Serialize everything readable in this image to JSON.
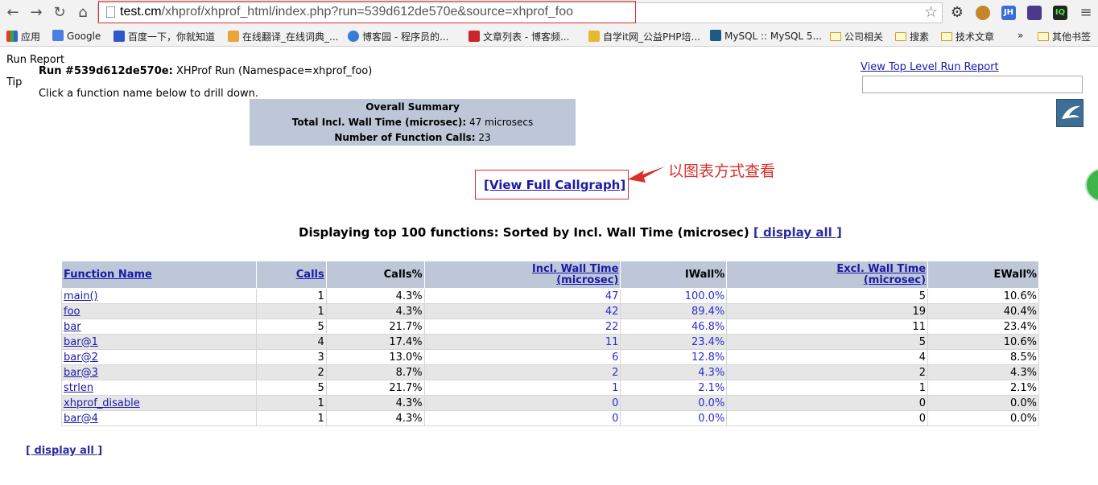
{
  "browser": {
    "url_host": "test.cm",
    "url_path": "/xhprof/xhprof_html/index.php?run=539d612de570e&source=xhprof_foo",
    "extensions": [
      "JH",
      "IQ"
    ],
    "bookmarks": [
      {
        "label": "应用",
        "icon": "apps-grid-icon"
      },
      {
        "label": "Google",
        "icon": "google-icon"
      },
      {
        "label": "百度一下，你就知道",
        "icon": "baidu-paw-icon"
      },
      {
        "label": "在线翻译_在线词典_...",
        "icon": "translate-icon"
      },
      {
        "label": "博客园 - 程序员的...",
        "icon": "cnblogs-icon"
      },
      {
        "label": "文章列表 - 博客频...",
        "icon": "csdn-icon"
      },
      {
        "label": "自学it网_公益PHP培...",
        "icon": "zixue-icon"
      },
      {
        "label": "MySQL :: MySQL 5...",
        "icon": "mysql-icon"
      },
      {
        "label": "公司相关",
        "icon": "folder-icon"
      },
      {
        "label": "搜素",
        "icon": "folder-icon"
      },
      {
        "label": "技术文章",
        "icon": "folder-icon"
      },
      {
        "label": "»",
        "icon": "overflow-icon"
      },
      {
        "label": "其他书签",
        "icon": "folder-icon"
      }
    ]
  },
  "page": {
    "run_report_label": "Run Report",
    "run_title": "Run #539d612de570e:",
    "run_desc": "XHProf Run (Namespace=xhprof_foo)",
    "tip_label": "Tip",
    "tip_text": "Click a function name below to drill down.",
    "top_level_link": "View Top Level Run Report",
    "summary": {
      "title": "Overall Summary",
      "wall_label": "Total Incl. Wall Time (microsec):",
      "wall_value": "47 microsecs",
      "calls_label": "Number of Function Calls:",
      "calls_value": "23"
    },
    "callgraph_link": "[View Full Callgraph]",
    "annotation": "以图表方式查看",
    "displaying_text": "Displaying top 100 functions: Sorted by Incl. Wall Time (microsec)",
    "display_all": "[ display all ]"
  },
  "table": {
    "headers": [
      "Function Name",
      "Calls",
      "Calls%",
      "Incl. Wall Time",
      "(microsec)",
      "IWall%",
      "Excl. Wall Time",
      "(microsec)",
      "EWall%"
    ],
    "rows": [
      [
        "main()",
        "1",
        "4.3%",
        "47",
        "100.0%",
        "5",
        "10.6%"
      ],
      [
        "foo",
        "1",
        "4.3%",
        "42",
        "89.4%",
        "19",
        "40.4%"
      ],
      [
        "bar",
        "5",
        "21.7%",
        "22",
        "46.8%",
        "11",
        "23.4%"
      ],
      [
        "bar@1",
        "4",
        "17.4%",
        "11",
        "23.4%",
        "5",
        "10.6%"
      ],
      [
        "bar@2",
        "3",
        "13.0%",
        "6",
        "12.8%",
        "4",
        "8.5%"
      ],
      [
        "bar@3",
        "2",
        "8.7%",
        "2",
        "4.3%",
        "2",
        "4.3%"
      ],
      [
        "strlen",
        "5",
        "21.7%",
        "1",
        "2.1%",
        "1",
        "2.1%"
      ],
      [
        "xhprof_disable",
        "1",
        "4.3%",
        "0",
        "0.0%",
        "0",
        "0.0%"
      ],
      [
        "bar@4",
        "1",
        "4.3%",
        "0",
        "0.0%",
        "0",
        "0.0%"
      ]
    ]
  }
}
